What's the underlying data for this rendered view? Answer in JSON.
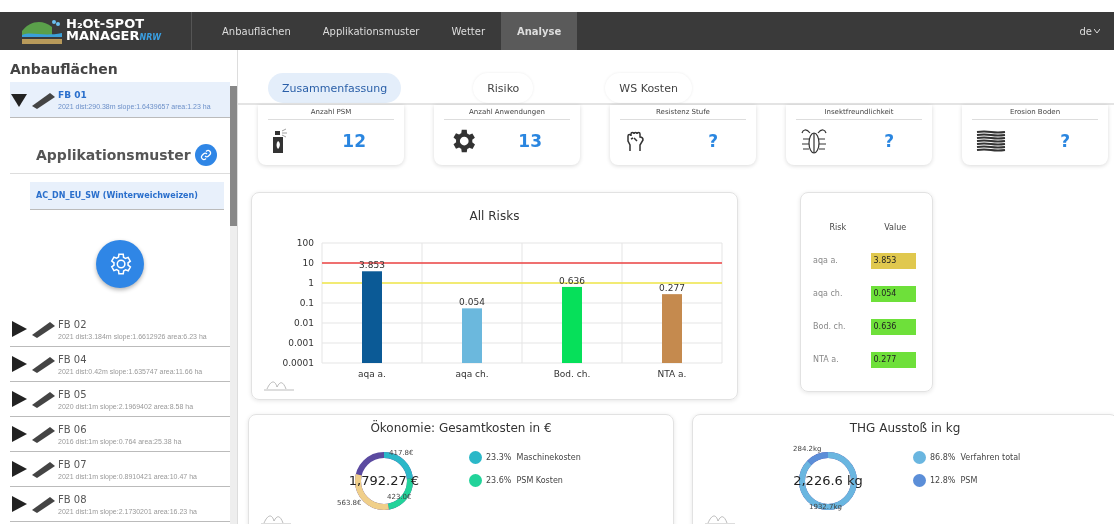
{
  "app": {
    "logo_line1": "H₂Ot-SPOT",
    "logo_line2": "MANAGER",
    "logo_suffix": "NRW"
  },
  "nav": [
    {
      "label": "Anbauflächen",
      "selected": false
    },
    {
      "label": "Applikationsmuster",
      "selected": false
    },
    {
      "label": "Wetter",
      "selected": false
    },
    {
      "label": "Analyse",
      "selected": true
    }
  ],
  "language": "de",
  "sidebar": {
    "title": "Anbauflächen",
    "fields": [
      {
        "name": "FB 01",
        "meta": "2021 dist:290.38m slope:1.6439657 area:1.23 ha",
        "expanded": true,
        "selected": true
      },
      {
        "name": "FB 02",
        "meta": "2021 dist:3.184m slope:1.6612926 area:6.23 ha",
        "expanded": false,
        "selected": false
      },
      {
        "name": "FB 04",
        "meta": "2021 dist:0.42m slope:1.635747 area:11.66 ha",
        "expanded": false,
        "selected": false
      },
      {
        "name": "FB 05",
        "meta": "2020 dist:1m slope:2.1969402 area:8.58 ha",
        "expanded": false,
        "selected": false
      },
      {
        "name": "FB 06",
        "meta": "2016 dist:1m slope:0.764 area:25.38 ha",
        "expanded": false,
        "selected": false
      },
      {
        "name": "FB 07",
        "meta": "2021 dist:1m slope:0.8910421 area:10.47 ha",
        "expanded": false,
        "selected": false
      },
      {
        "name": "FB 08",
        "meta": "2021 dist:1m slope:2.1730201 area:16.23 ha",
        "expanded": false,
        "selected": false
      }
    ],
    "pattern_title": "Applikationsmuster",
    "patterns": [
      {
        "label": "AC_DN_EU_SW (Winterweichweizen)",
        "selected": true
      }
    ]
  },
  "tabs": [
    {
      "label": "Zusammenfassung",
      "selected": true
    },
    {
      "label": "Risiko",
      "selected": false
    },
    {
      "label": "WS Kosten",
      "selected": false
    }
  ],
  "stats": [
    {
      "kind": "spray",
      "title": "Anzahl PSM",
      "value": "12"
    },
    {
      "kind": "gear",
      "title": "Anzahl Anwendungen",
      "value": "13"
    },
    {
      "kind": "fist",
      "title": "Resistenz Stufe",
      "value": "?"
    },
    {
      "kind": "bug",
      "title": "Insektfreundlichkeit",
      "value": "?"
    },
    {
      "kind": "layers",
      "title": "Erosion Boden",
      "value": "?"
    }
  ],
  "risk_chart": {
    "title": "All Risks",
    "y_axis_labels": [
      "100",
      "10",
      "1",
      "0.1",
      "0.01",
      "0.001",
      "0.0001"
    ],
    "bars": [
      {
        "label": "aqa a.",
        "value": "3.853",
        "color": "#0b5a96"
      },
      {
        "label": "aqa ch.",
        "value": "0.054",
        "color": "#6bb8dd"
      },
      {
        "label": "Bod. ch.",
        "value": "0.636",
        "color": "#06e05a"
      },
      {
        "label": "NTA a.",
        "value": "0.277",
        "color": "#c58a4e"
      }
    ]
  },
  "risk_table": {
    "columns": [
      "Risk",
      "Value"
    ],
    "rows": [
      {
        "risk": "aqa a.",
        "value": "3.853",
        "color": "#e0c84e"
      },
      {
        "risk": "aqa ch.",
        "value": "0.054",
        "color": "#6ee03a"
      },
      {
        "risk": "Bod. ch.",
        "value": "0.636",
        "color": "#6ee03a"
      },
      {
        "risk": "NTA a.",
        "value": "0.277",
        "color": "#6ee03a"
      }
    ]
  },
  "donuts": [
    {
      "title": "Ökonomie: Gesamtkosten in €",
      "total": "1,792.27 €",
      "slices": [
        {
          "label": "417.8€",
          "color": "#2bb8c8"
        },
        {
          "label": "423.0€",
          "color": "#22d39a"
        },
        {
          "label": "563.8€",
          "color": "#f0cf8a"
        }
      ],
      "legend": [
        {
          "percent": "23.3%",
          "label": "Maschinekosten",
          "color": "#2bb8c8"
        },
        {
          "percent": "23.6%",
          "label": "PSM Kosten",
          "color": "#22d39a"
        }
      ]
    },
    {
      "title": "THG Ausstoß in kg",
      "total": "2,226.6 kg",
      "slices": [
        {
          "label": "1932.7kg",
          "color": "#6ab6e0"
        },
        {
          "label": "284.2kg",
          "color": "#5b8ed8"
        }
      ],
      "legend": [
        {
          "percent": "86.8%",
          "label": "Verfahren total",
          "color": "#6ab6e0"
        },
        {
          "percent": "12.8%",
          "label": "PSM",
          "color": "#5b8ed8"
        }
      ]
    }
  ]
}
